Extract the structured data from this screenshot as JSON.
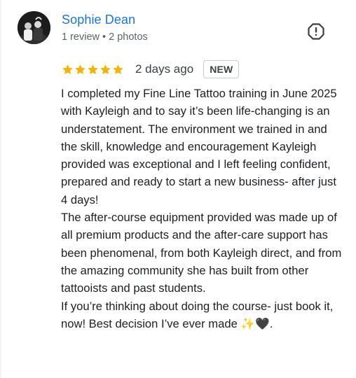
{
  "reviewer": {
    "name": "Sophie Dean",
    "reviews": "1 review",
    "separator": "•",
    "photos": "2 photos"
  },
  "rating": {
    "stars": 5,
    "max_stars": 5,
    "time_ago": "2 days ago",
    "badge": "NEW"
  },
  "review": {
    "paragraph_1": "I completed my Fine Line Tattoo training in June 2025 with Kayleigh and to say it’s been life-changing is an understatement. The environment we trained in and the skill, knowledge and encouragement Kayleigh provided was exceptional and I left feeling confident, prepared and ready to start a new business- after just 4 days!",
    "paragraph_2": "The after-course equipment provided was made up of all premium products and the after-care support has been phenomenal, from both Kayleigh direct, and from the amazing community she has built from other tattooists and past students.",
    "paragraph_3": "If you’re thinking about doing the course- just book it, now! Best decision I’ve ever made ",
    "emoji_1": "✨",
    "emoji_2": "🖤",
    "end": "."
  },
  "colors": {
    "name": "#1a73e8",
    "star": "#f4b400",
    "meta": "#5f6368"
  },
  "icons": {
    "report": "report-flag-icon",
    "star": "star-icon"
  }
}
